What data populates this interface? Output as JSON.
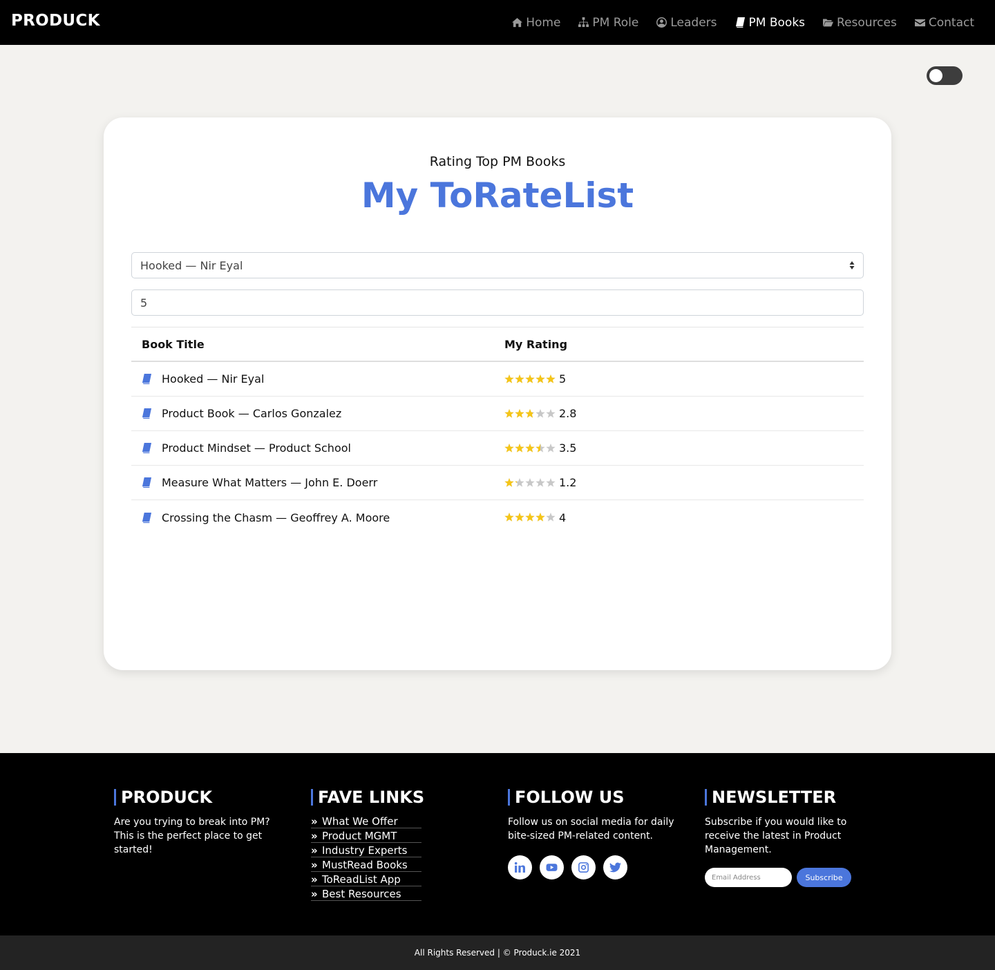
{
  "brand": "PRODUCK",
  "nav": [
    {
      "label": "Home",
      "icon": "home-icon",
      "active": false
    },
    {
      "label": "PM Role",
      "icon": "sitemap-icon",
      "active": false
    },
    {
      "label": "Leaders",
      "icon": "user-circle-icon",
      "active": false
    },
    {
      "label": "PM Books",
      "icon": "book-icon",
      "active": true
    },
    {
      "label": "Resources",
      "icon": "folder-open-icon",
      "active": false
    },
    {
      "label": "Contact",
      "icon": "envelope-icon",
      "active": false
    }
  ],
  "theme_toggle": {
    "on": false
  },
  "card": {
    "subtitle": "Rating Top PM Books",
    "title": "My ToRateList",
    "select_value": "Hooked — Nir Eyal",
    "rating_input_value": "5",
    "table": {
      "headers": [
        "Book Title",
        "My Rating"
      ],
      "rows": [
        {
          "title": "Hooked — Nir Eyal",
          "rating": "5"
        },
        {
          "title": "Product Book — Carlos Gonzalez",
          "rating": "2.8"
        },
        {
          "title": "Product Mindset — Product School",
          "rating": "3.5"
        },
        {
          "title": "Measure What Matters — John E. Doerr",
          "rating": "1.2"
        },
        {
          "title": "Crossing the Chasm — Geoffrey A. Moore",
          "rating": "4"
        }
      ]
    }
  },
  "footer": {
    "about": {
      "heading": "PRODUCK",
      "text": "Are you trying to break into PM? This is the perfect place to get started!"
    },
    "links": {
      "heading": "FAVE LINKS",
      "items": [
        "What We Offer",
        "Product MGMT",
        "Industry Experts",
        "MustRead Books",
        "ToReadList App",
        "Best Resources"
      ]
    },
    "follow": {
      "heading": "FOLLOW US",
      "text": "Follow us on social media for daily bite-sized PM-related content.",
      "icons": [
        "linkedin-icon",
        "youtube-icon",
        "instagram-icon",
        "twitter-icon"
      ]
    },
    "newsletter": {
      "heading": "NEWSLETTER",
      "text": "Subscribe if you would like to receive the latest in Product Management.",
      "email_placeholder": "Email Address",
      "button": "Subscribe"
    }
  },
  "copyright": "All Rights Reserved | © Produck.ie 2021",
  "colors": {
    "accent": "#4b76dc",
    "star": "#f5c518",
    "star_empty": "#c8c8c8"
  }
}
